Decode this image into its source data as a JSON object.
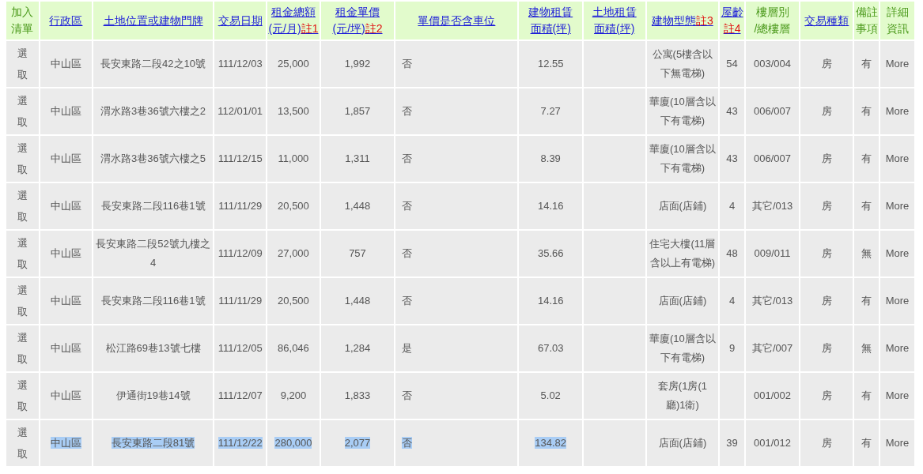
{
  "table": {
    "columns": [
      {
        "lines": [
          "加入",
          "清單"
        ],
        "link": false
      },
      {
        "lines": [
          "行政區"
        ],
        "link": true
      },
      {
        "lines": [
          "土地位置或建物門牌"
        ],
        "link": true
      },
      {
        "lines": [
          "交易日期"
        ],
        "link": true
      },
      {
        "lines": [
          "租金總額",
          "(元/月)"
        ],
        "note": "註1",
        "link": true
      },
      {
        "lines": [
          "租金單價",
          "(元/坪)"
        ],
        "note": "註2",
        "link": true
      },
      {
        "lines": [
          "單價是否含車位"
        ],
        "link": true
      },
      {
        "lines": [
          "建物租賃",
          "面積(坪)"
        ],
        "link": true
      },
      {
        "lines": [
          "土地租賃",
          "面積(坪)"
        ],
        "link": true
      },
      {
        "lines": [
          "建物型態"
        ],
        "note": "註3",
        "link": true
      },
      {
        "lines": [
          "屋齡"
        ],
        "note": "註4",
        "link": true
      },
      {
        "lines": [
          "樓層別",
          "/總樓層"
        ],
        "link": false
      },
      {
        "lines": [
          "交易種類"
        ],
        "link": true
      },
      {
        "lines": [
          "備註",
          "事項"
        ],
        "link": false
      },
      {
        "lines": [
          "詳細",
          "資訊"
        ],
        "link": false
      }
    ],
    "rows": [
      {
        "cells": [
          "選取",
          "中山區",
          "長安東路二段42之10號",
          "111/12/03",
          "25,000",
          "1,992",
          "否",
          "12.55",
          null,
          "公寓(5樓含以下無電梯)",
          "54",
          "003/004",
          "房",
          "有",
          "More"
        ]
      },
      {
        "cells": [
          "選取",
          "中山區",
          "渭水路3巷36號六樓之2",
          "112/01/01",
          "13,500",
          "1,857",
          "否",
          "7.27",
          null,
          "華廈(10層含以下有電梯)",
          "43",
          "006/007",
          "房",
          "有",
          "More"
        ]
      },
      {
        "cells": [
          "選取",
          "中山區",
          "渭水路3巷36號六樓之5",
          "111/12/15",
          "11,000",
          "1,311",
          "否",
          "8.39",
          null,
          "華廈(10層含以下有電梯)",
          "43",
          "006/007",
          "房",
          "有",
          "More"
        ]
      },
      {
        "cells": [
          "選取",
          "中山區",
          "長安東路二段116巷1號",
          "111/11/29",
          "20,500",
          "1,448",
          "否",
          "14.16",
          null,
          "店面(店鋪)",
          "4",
          "其它/013",
          "房",
          "有",
          "More"
        ]
      },
      {
        "cells": [
          "選取",
          "中山區",
          "長安東路二段52號九樓之4",
          "111/12/09",
          "27,000",
          "757",
          "否",
          "35.66",
          null,
          "住宅大樓(11層含以上有電梯)",
          "48",
          "009/011",
          "房",
          "無",
          "More"
        ]
      },
      {
        "cells": [
          "選取",
          "中山區",
          "長安東路二段116巷1號",
          "111/11/29",
          "20,500",
          "1,448",
          "否",
          "14.16",
          null,
          "店面(店鋪)",
          "4",
          "其它/013",
          "房",
          "有",
          "More"
        ]
      },
      {
        "cells": [
          "選取",
          "中山區",
          "松江路69巷13號七樓",
          "111/12/05",
          "86,046",
          "1,284",
          "是",
          "67.03",
          null,
          "華廈(10層含以下有電梯)",
          "9",
          "其它/007",
          "房",
          "無",
          "More"
        ]
      },
      {
        "cells": [
          "選取",
          "中山區",
          "伊通街19巷14號",
          "111/12/07",
          "9,200",
          "1,833",
          "否",
          "5.02",
          null,
          "套房(1房(1廳)1衛)",
          null,
          "001/002",
          "房",
          "有",
          "More"
        ]
      },
      {
        "cells": [
          "選取",
          {
            "text": "中山區",
            "selected": true
          },
          {
            "text": "長安東路二段81號",
            "selected": true
          },
          {
            "text": "111/12/22",
            "selected": true
          },
          {
            "text": "280,000",
            "selected": true
          },
          {
            "text": "2,077",
            "selected": true
          },
          {
            "text": "否",
            "selected": true
          },
          {
            "text": "134.82",
            "selected": true
          },
          null,
          "店面(店鋪)",
          "39",
          "001/012",
          "房",
          "有",
          "More"
        ]
      }
    ]
  }
}
